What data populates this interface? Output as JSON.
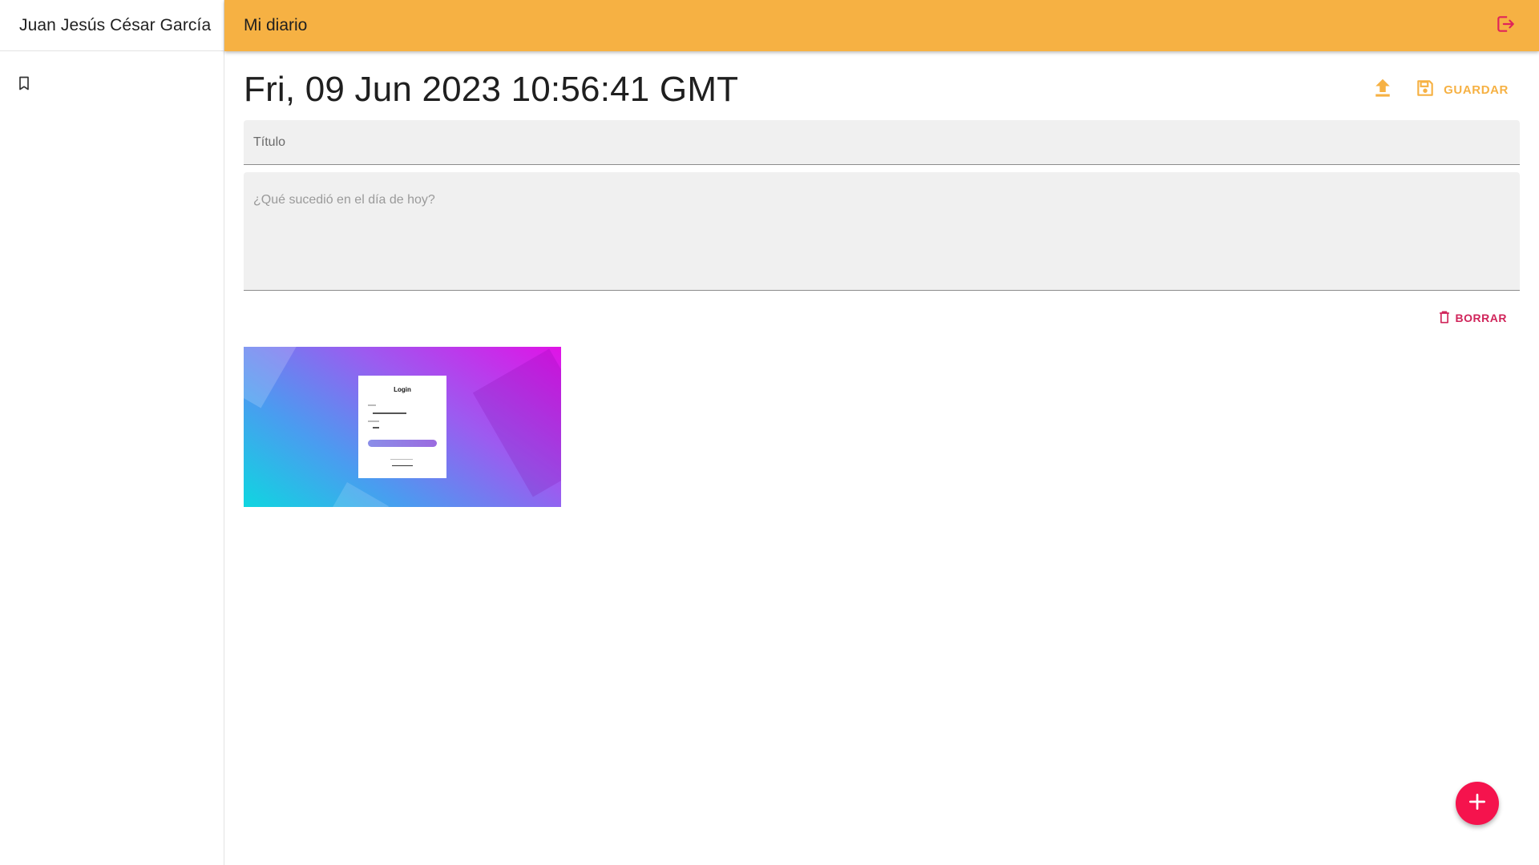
{
  "sidebar": {
    "user_name": "Juan Jesús César García",
    "items": [
      {
        "icon": "bookmark-icon"
      }
    ]
  },
  "appbar": {
    "title": "Mi diario",
    "logout_icon": "logout-icon"
  },
  "note": {
    "date": "Fri, 09 Jun 2023 10:56:41 GMT",
    "upload_icon": "upload-icon",
    "save_label": "GUARDAR",
    "title_placeholder": "Título",
    "title_value": "",
    "body_placeholder": "¿Qué sucedió en el día de hoy?",
    "body_value": "",
    "delete_label": "BORRAR",
    "images": [
      {
        "description_card_title": "Login"
      }
    ]
  },
  "fab": {
    "icon": "plus-icon"
  },
  "colors": {
    "primary": "#f6b143",
    "danger": "#d0245a",
    "fab": "#f5134d"
  }
}
